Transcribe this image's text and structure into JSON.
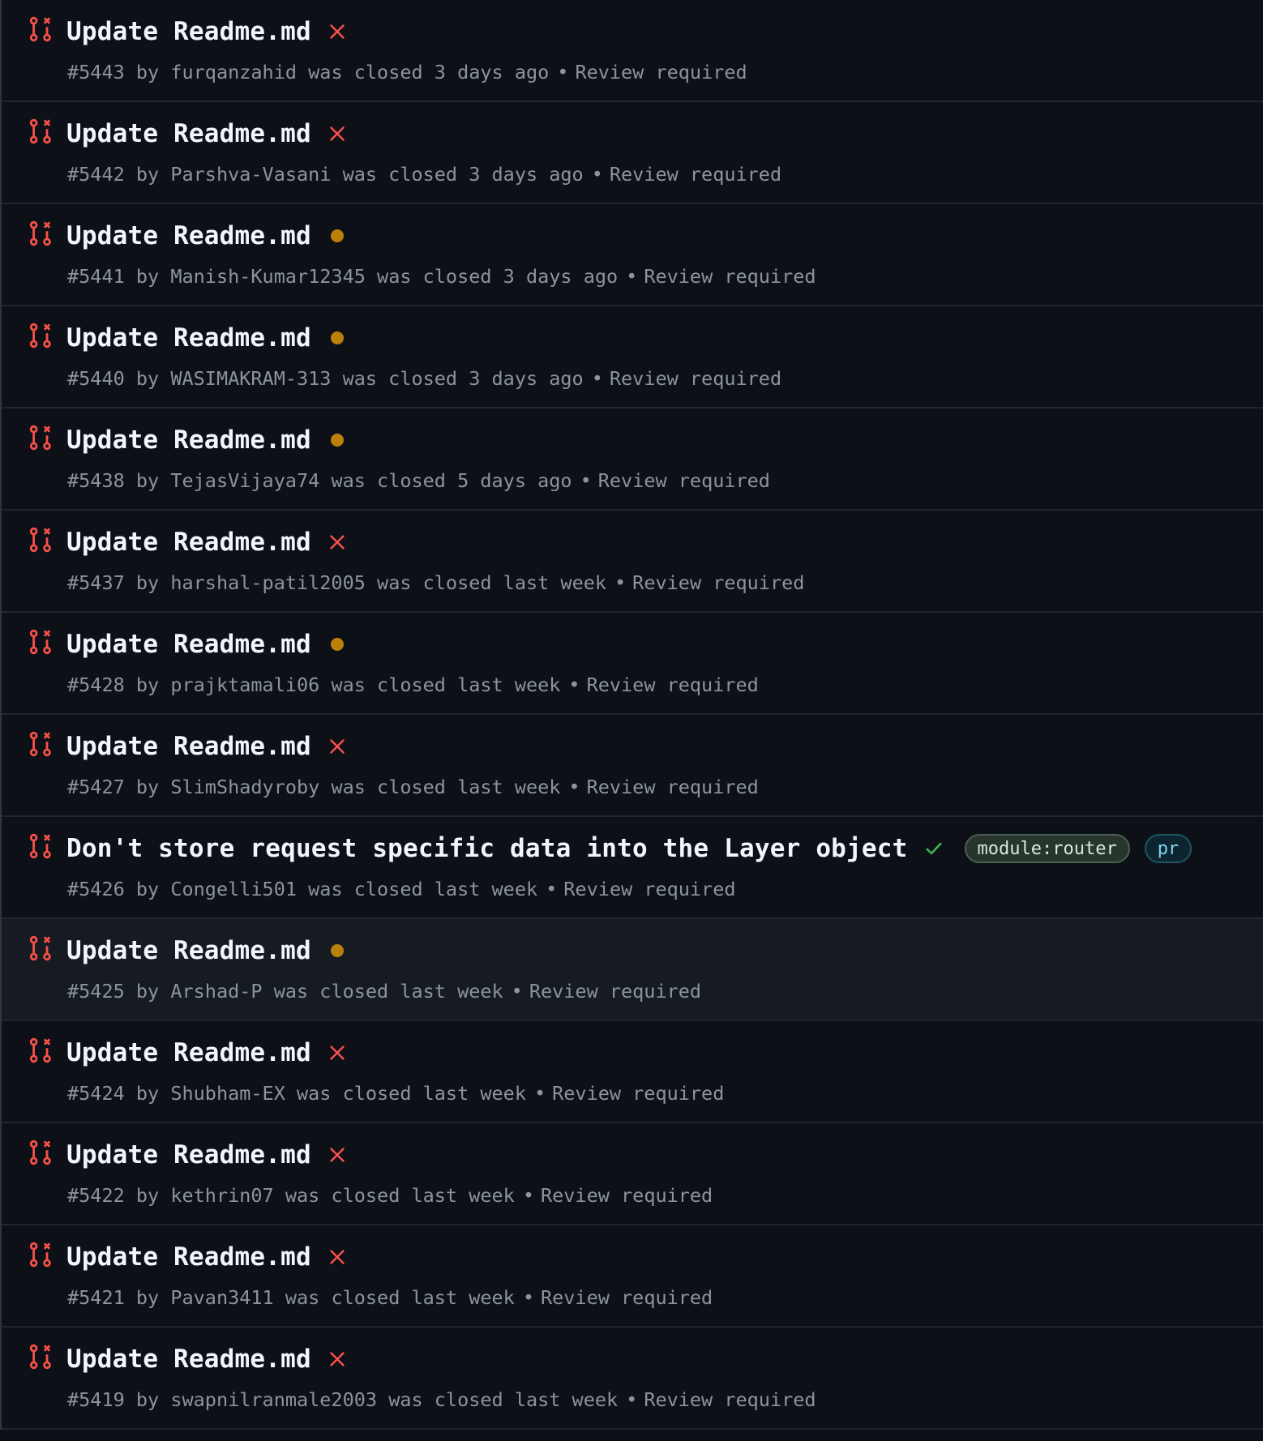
{
  "colors": {
    "background": "#0d1117",
    "row_hover_background": "#161b22",
    "closed_pr_icon": "#f85149",
    "status_failure": "#f85149",
    "status_pending": "#bb8009",
    "status_success": "#3fb950",
    "muted_text": "#8b949e",
    "title_text": "#f0f6fc"
  },
  "icons": {
    "pr_closed": "git-pull-request-closed-icon",
    "status_failure": "x-icon",
    "status_pending": "dot-icon",
    "status_success": "check-icon"
  },
  "pull_requests": [
    {
      "title": "Update Readme.md",
      "status": "failure",
      "number": "#5443",
      "by": "by",
      "author": "furqanzahid",
      "closed_text": "was closed 3 days ago",
      "separator": "•",
      "review": "Review required"
    },
    {
      "title": "Update Readme.md",
      "status": "failure",
      "number": "#5442",
      "by": "by",
      "author": "Parshva-Vasani",
      "closed_text": "was closed 3 days ago",
      "separator": "•",
      "review": "Review required"
    },
    {
      "title": "Update Readme.md",
      "status": "pending",
      "number": "#5441",
      "by": "by",
      "author": "Manish-Kumar12345",
      "closed_text": "was closed 3 days ago",
      "separator": "•",
      "review": "Review required"
    },
    {
      "title": "Update Readme.md",
      "status": "pending",
      "number": "#5440",
      "by": "by",
      "author": "WASIMAKRAM-313",
      "closed_text": "was closed 3 days ago",
      "separator": "•",
      "review": "Review required"
    },
    {
      "title": "Update Readme.md",
      "status": "pending",
      "number": "#5438",
      "by": "by",
      "author": "TejasVijaya74",
      "closed_text": "was closed 5 days ago",
      "separator": "•",
      "review": "Review required"
    },
    {
      "title": "Update Readme.md",
      "status": "failure",
      "number": "#5437",
      "by": "by",
      "author": "harshal-patil2005",
      "closed_text": "was closed last week",
      "separator": "•",
      "review": "Review required"
    },
    {
      "title": "Update Readme.md",
      "status": "pending",
      "number": "#5428",
      "by": "by",
      "author": "prajktamali06",
      "closed_text": "was closed last week",
      "separator": "•",
      "review": "Review required"
    },
    {
      "title": "Update Readme.md",
      "status": "failure",
      "number": "#5427",
      "by": "by",
      "author": "SlimShadyroby",
      "closed_text": "was closed last week",
      "separator": "•",
      "review": "Review required"
    },
    {
      "title": "Don't store request specific data into the Layer object",
      "status": "success",
      "labels": [
        "module:router",
        "pr"
      ],
      "number": "#5426",
      "by": "by",
      "author": "Congelli501",
      "closed_text": "was closed last week",
      "separator": "•",
      "review": "Review required"
    },
    {
      "title": "Update Readme.md",
      "status": "pending",
      "hovered": true,
      "number": "#5425",
      "by": "by",
      "author": "Arshad-P",
      "closed_text": "was closed last week",
      "separator": "•",
      "review": "Review required"
    },
    {
      "title": "Update Readme.md",
      "status": "failure",
      "number": "#5424",
      "by": "by",
      "author": "Shubham-EX",
      "closed_text": "was closed last week",
      "separator": "•",
      "review": "Review required"
    },
    {
      "title": "Update Readme.md",
      "status": "failure",
      "number": "#5422",
      "by": "by",
      "author": "kethrin07",
      "closed_text": "was closed last week",
      "separator": "•",
      "review": "Review required"
    },
    {
      "title": "Update Readme.md",
      "status": "failure",
      "number": "#5421",
      "by": "by",
      "author": "Pavan3411",
      "closed_text": "was closed last week",
      "separator": "•",
      "review": "Review required"
    },
    {
      "title": "Update Readme.md",
      "status": "failure",
      "number": "#5419",
      "by": "by",
      "author": "swapnilranmale2003",
      "closed_text": "was closed last week",
      "separator": "•",
      "review": "Review required"
    }
  ]
}
